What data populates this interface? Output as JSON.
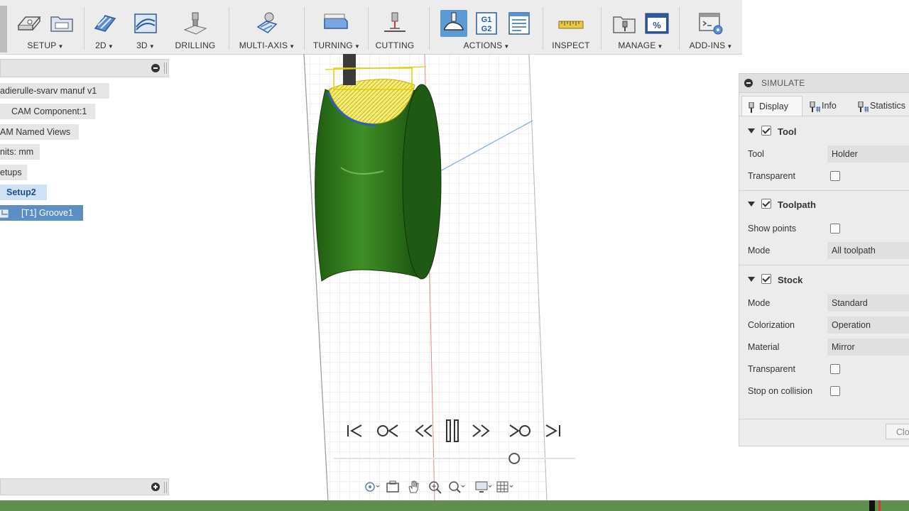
{
  "toolbar": {
    "groups": [
      {
        "id": "setup",
        "label": "SETUP",
        "dropdown": true
      },
      {
        "id": "2d",
        "label": "2D",
        "dropdown": true
      },
      {
        "id": "3d",
        "label": "3D",
        "dropdown": true
      },
      {
        "id": "drilling",
        "label": "DRILLING",
        "dropdown": false
      },
      {
        "id": "multiaxis",
        "label": "MULTI-AXIS",
        "dropdown": true
      },
      {
        "id": "turning",
        "label": "TURNING",
        "dropdown": true
      },
      {
        "id": "cutting",
        "label": "CUTTING",
        "dropdown": false
      },
      {
        "id": "actions",
        "label": "ACTIONS",
        "dropdown": true
      },
      {
        "id": "inspect",
        "label": "INSPECT",
        "dropdown": false
      },
      {
        "id": "manage",
        "label": "MANAGE",
        "dropdown": true
      },
      {
        "id": "addins",
        "label": "ADD-INS",
        "dropdown": true
      }
    ],
    "gcode_icon_text": [
      "G1",
      "G2"
    ],
    "post_icon_text": "%"
  },
  "browser": {
    "nodes": [
      {
        "label": "adierulle-svarv manuf v1",
        "kind": "doc"
      },
      {
        "label": "CAM Component:1",
        "kind": "component"
      },
      {
        "label": "AM Named Views",
        "kind": "views"
      },
      {
        "label": "nits: mm",
        "kind": "units"
      },
      {
        "label": "etups",
        "kind": "setups"
      },
      {
        "label": "Setup2",
        "kind": "setup"
      },
      {
        "label": "[T1] Groove1",
        "kind": "operation"
      }
    ]
  },
  "simulate": {
    "title": "SIMULATE",
    "tabs": [
      {
        "label": "Display",
        "active": true
      },
      {
        "label": "Info",
        "active": false
      },
      {
        "label": "Statistics",
        "active": false
      }
    ],
    "sections": {
      "tool": {
        "title": "Tool",
        "checked": true,
        "tool_label": "Tool",
        "tool_value": "Holder",
        "transparent_label": "Transparent",
        "transparent": false
      },
      "toolpath": {
        "title": "Toolpath",
        "checked": true,
        "show_points_label": "Show points",
        "show_points": false,
        "mode_label": "Mode",
        "mode_value": "All toolpath"
      },
      "stock": {
        "title": "Stock",
        "checked": true,
        "mode_label": "Mode",
        "mode_value": "Standard",
        "colorization_label": "Colorization",
        "colorization_value": "Operation",
        "material_label": "Material",
        "material_value": "Mirror",
        "transparent_label": "Transparent",
        "transparent": false,
        "stop_label": "Stop on collision",
        "stop_on_collision": false
      }
    },
    "close_label": "Clo"
  },
  "playback": {
    "position": 0.62
  },
  "colors": {
    "accent": "#5a9bd5",
    "stock_green": "#2e7d1e",
    "statusbar": "#5f8f4c",
    "selected_op": "#5b8fc4"
  }
}
